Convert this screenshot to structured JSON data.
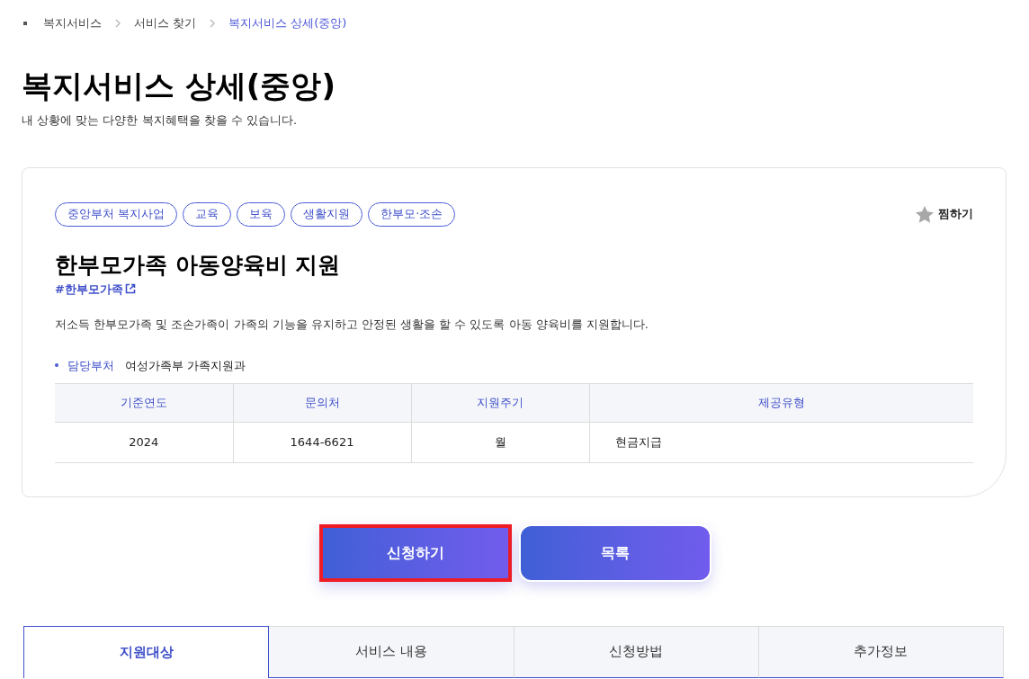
{
  "breadcrumb": [
    {
      "label": "복지서비스",
      "selected": false
    },
    {
      "label": "서비스 찾기",
      "selected": false
    },
    {
      "label": "복지서비스 상세(중앙)",
      "selected": true
    }
  ],
  "page": {
    "title": "복지서비스 상세(중앙)",
    "subtitle": "내 상황에 맞는 다양한 복지혜택을 찾을 수 있습니다."
  },
  "card": {
    "tags": [
      "중앙부처 복지사업",
      "교육",
      "보육",
      "생활지원",
      "한부모·조손"
    ],
    "favorite": {
      "label": "찜하기",
      "on": false
    },
    "title": "한부모가족 아동양육비 지원",
    "hashtag": "#한부모가족",
    "description": "저소득 한부모가족 및 조손가족이 가족의 기능을 유지하고 안정된 생활을 할 수 있도록 아동 양육비를 지원합니다.",
    "department": {
      "label": "담당부처",
      "value": "여성가족부 가족지원과"
    },
    "table": {
      "columns": [
        "기준연도",
        "문의처",
        "지원주기",
        "제공유형"
      ],
      "rows": [
        [
          "2024",
          "1644-6621",
          "월",
          "현금지급"
        ]
      ]
    }
  },
  "buttons": [
    {
      "label": "신청하기",
      "highlighted": true
    },
    {
      "label": "목록",
      "highlighted": false
    }
  ],
  "tabs": [
    {
      "label": "지원대상",
      "selected": true
    },
    {
      "label": "서비스 내용",
      "selected": false
    },
    {
      "label": "신청방법",
      "selected": false
    },
    {
      "label": "추가정보",
      "selected": false
    }
  ]
}
